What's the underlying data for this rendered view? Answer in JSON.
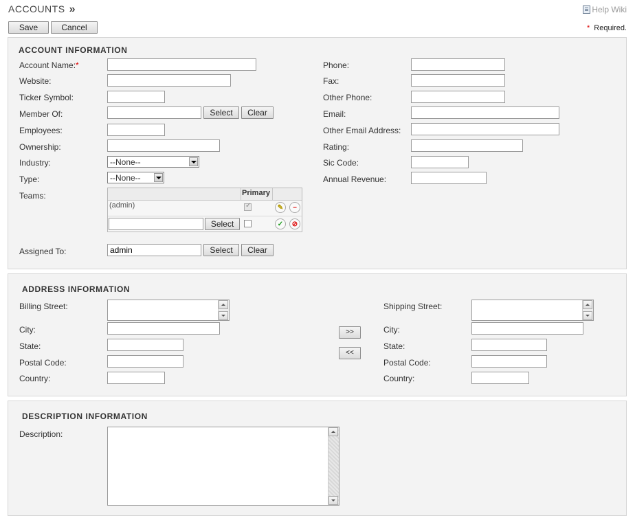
{
  "header": {
    "title": "ACCOUNTS",
    "raquo": "»",
    "help_wiki": "Help Wiki"
  },
  "toolbar": {
    "save_label": "Save",
    "cancel_label": "Cancel",
    "required_star": "*",
    "required_text": "Required."
  },
  "account_info": {
    "title": "ACCOUNT INFORMATION",
    "labels": {
      "account_name": "Account Name:",
      "website": "Website:",
      "ticker_symbol": "Ticker Symbol:",
      "member_of": "Member Of:",
      "employees": "Employees:",
      "ownership": "Ownership:",
      "industry": "Industry:",
      "type": "Type:",
      "teams": "Teams:",
      "assigned_to": "Assigned To:",
      "phone": "Phone:",
      "fax": "Fax:",
      "other_phone": "Other Phone:",
      "email": "Email:",
      "other_email": "Other Email Address:",
      "rating": "Rating:",
      "sic_code": "Sic Code:",
      "annual_revenue": "Annual Revenue:"
    },
    "required_star": "*",
    "values": {
      "account_name": "",
      "website": "",
      "ticker_symbol": "",
      "member_of": "",
      "employees": "",
      "ownership": "",
      "phone": "",
      "fax": "",
      "other_phone": "",
      "email": "",
      "other_email": "",
      "rating": "",
      "sic_code": "",
      "annual_revenue": "",
      "assigned_to": "admin",
      "team_new": ""
    },
    "industry_selected": "--None--",
    "type_selected": "--None--",
    "select_label": "Select",
    "clear_label": "Clear",
    "teams": {
      "primary_header": "Primary",
      "rows": [
        {
          "name": "(admin)",
          "primary": true
        }
      ]
    }
  },
  "address_info": {
    "title": "ADDRESS INFORMATION",
    "labels": {
      "billing_street": "Billing Street:",
      "city": "City:",
      "state": "State:",
      "postal_code": "Postal Code:",
      "country": "Country:",
      "shipping_street": "Shipping Street:"
    },
    "copy_right": ">>",
    "copy_left": "<<"
  },
  "description_info": {
    "title": "DESCRIPTION INFORMATION",
    "label": "Description:",
    "value": ""
  },
  "colors": {
    "required": "#dd0000",
    "panel_bg": "#f3f3f3",
    "panel_border": "#d6d6d6"
  },
  "icons": {
    "help": "help-page-icon",
    "edit": "pencil-icon",
    "remove": "minus-circle-icon",
    "confirm": "checkmark-icon",
    "cancel": "no-entry-icon"
  }
}
